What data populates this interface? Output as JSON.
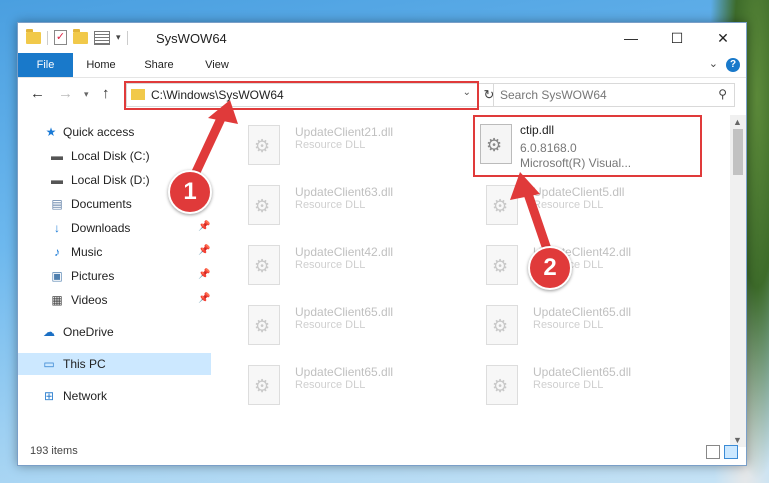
{
  "window": {
    "title": "SysWOW64",
    "controls": {
      "minimize": "—",
      "maximize": "☐",
      "close": "✕"
    }
  },
  "ribbon": {
    "tabs": [
      "File",
      "Home",
      "Share",
      "View"
    ],
    "help": "?"
  },
  "address": {
    "path": "C:\\Windows\\SysWOW64",
    "search_placeholder": "Search SysWOW64"
  },
  "sidebar": {
    "items": [
      {
        "label": "Quick access",
        "icon": "star-icon",
        "pinned": false
      },
      {
        "label": "Local Disk (C:)",
        "icon": "drive-icon",
        "pinned": false
      },
      {
        "label": "Local Disk (D:)",
        "icon": "drive-icon",
        "pinned": false
      },
      {
        "label": "Documents",
        "icon": "document-icon",
        "pinned": true
      },
      {
        "label": "Downloads",
        "icon": "download-icon",
        "pinned": true
      },
      {
        "label": "Music",
        "icon": "music-icon",
        "pinned": true
      },
      {
        "label": "Pictures",
        "icon": "picture-icon",
        "pinned": true
      },
      {
        "label": "Videos",
        "icon": "video-icon",
        "pinned": true
      },
      {
        "label": "OneDrive",
        "icon": "cloud-icon",
        "pinned": false
      },
      {
        "label": "This PC",
        "icon": "computer-icon",
        "pinned": false,
        "selected": true
      },
      {
        "label": "Network",
        "icon": "network-icon",
        "pinned": false
      }
    ]
  },
  "files": {
    "items": [
      {
        "name": "UpdateClient21.dll",
        "type": "Resource DLL"
      },
      {
        "name": "UpdateClient63.dll",
        "type": "Resource DLL"
      },
      {
        "name": "UpdateClient5.dll",
        "type": "Resource DLL"
      },
      {
        "name": "UpdateClient42.dll",
        "type": "Resource DLL"
      },
      {
        "name": "UpdateClient42.dll",
        "type": "Resource DLL"
      },
      {
        "name": "UpdateClient65.dll",
        "type": "Resource DLL"
      },
      {
        "name": "UpdateClient65.dll",
        "type": "Resource DLL"
      },
      {
        "name": "UpdateClient65.dll",
        "type": "Resource DLL"
      },
      {
        "name": "UpdateClient65.dll",
        "type": "Resource DLL"
      }
    ],
    "selected": {
      "name": "ctip.dll",
      "version": "6.0.8168.0",
      "description": "Microsoft(R) Visual..."
    }
  },
  "status": {
    "count": "193 items"
  },
  "callouts": {
    "one": "1",
    "two": "2"
  },
  "colors": {
    "accent": "#1979ca",
    "highlight": "#e03a3a",
    "selection": "#cce8ff"
  }
}
